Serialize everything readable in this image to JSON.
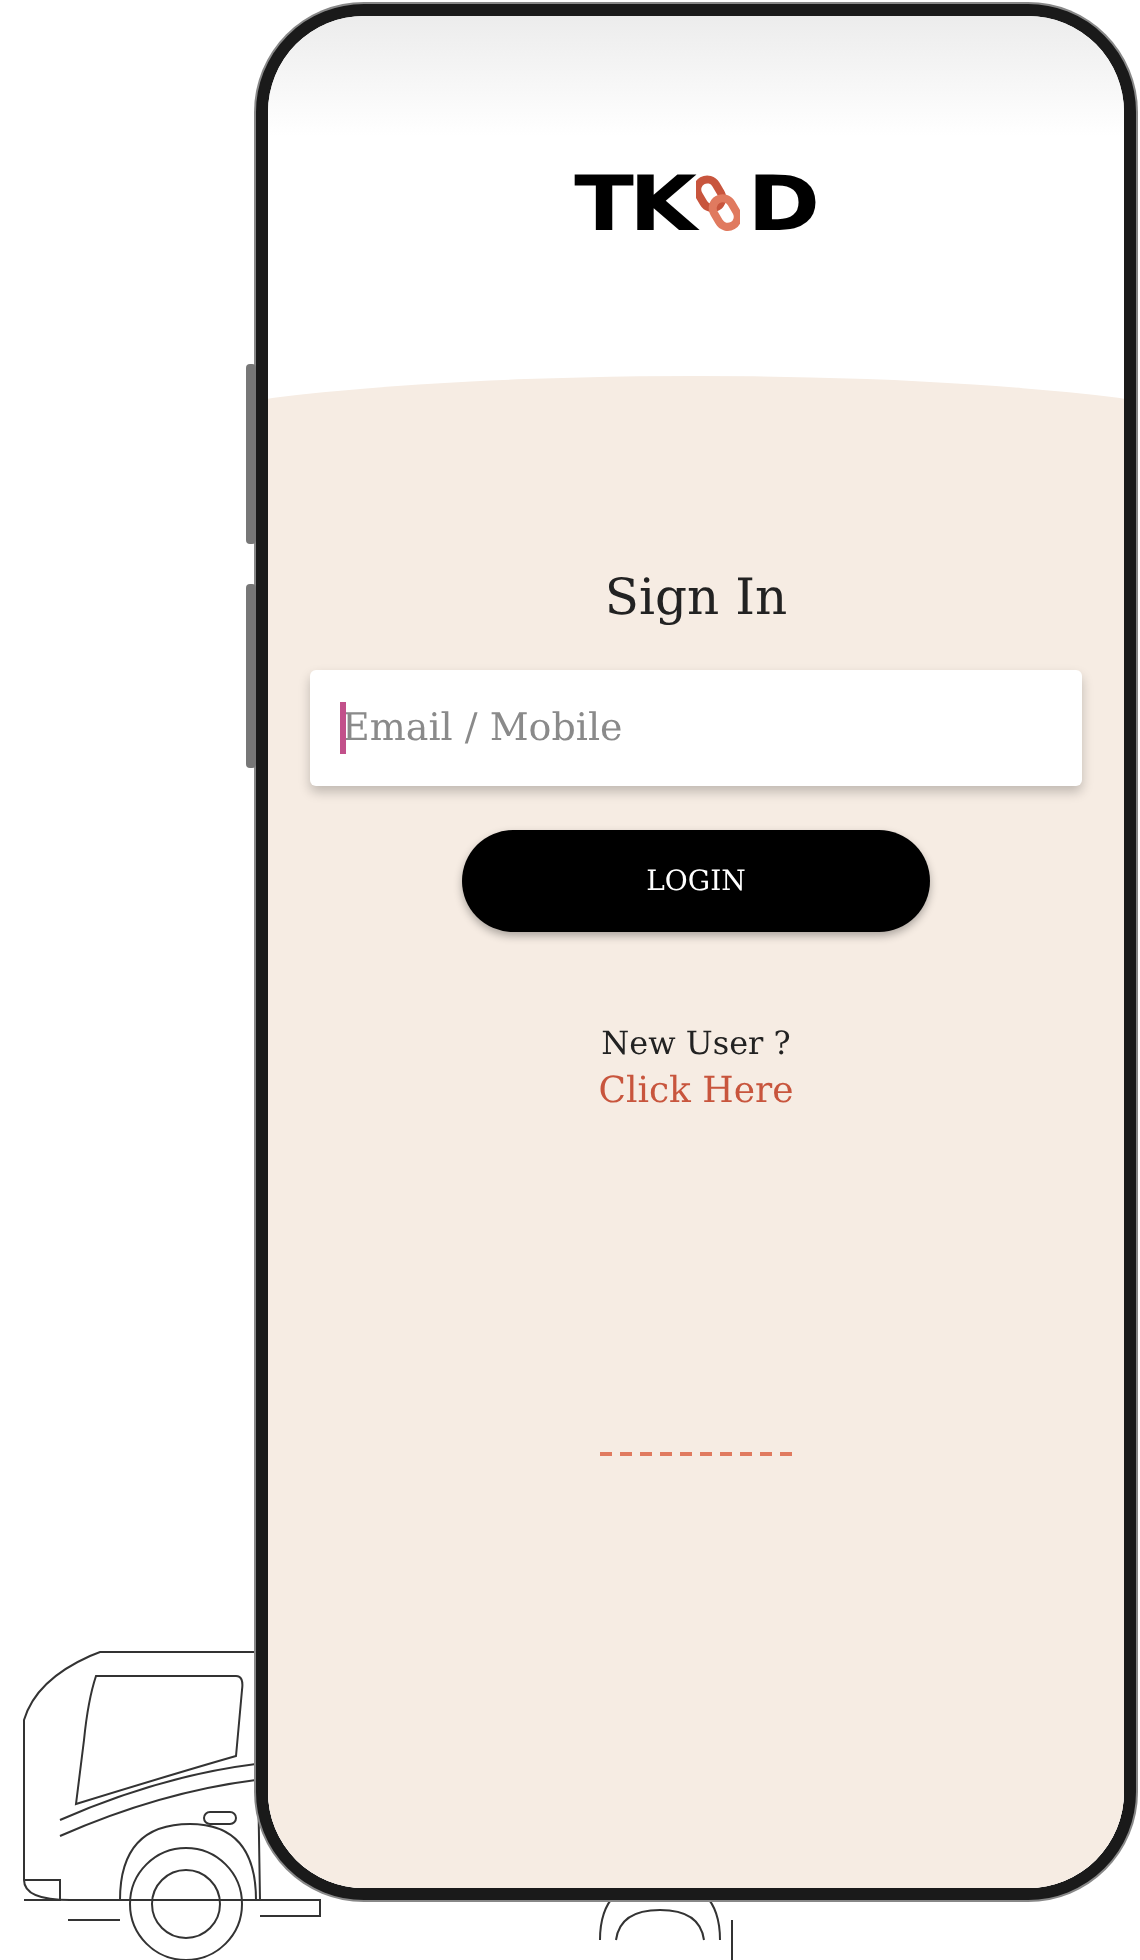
{
  "logo": {
    "left": "TK",
    "right": "D"
  },
  "title": "Sign In",
  "login_field": {
    "placeholder": "Email / Mobile",
    "focused": true
  },
  "login_button": "LOGIN",
  "signup": {
    "prompt": "New User ?",
    "link": "Click Here"
  }
}
